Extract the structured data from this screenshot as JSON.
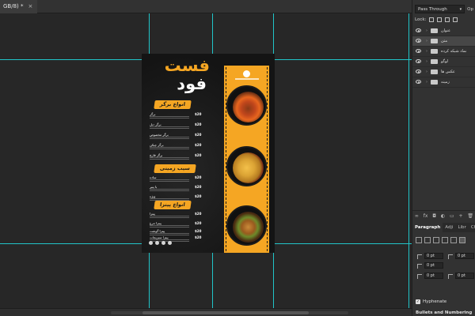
{
  "document_tab": {
    "title": "GB/8) *",
    "close_glyph": "×"
  },
  "poster": {
    "headline_1": "فست",
    "headline_2": "فود",
    "sections": [
      {
        "badge": "انواع برگر"
      },
      {
        "badge": "سیب زمینی"
      },
      {
        "badge": "انواع پیتزا"
      }
    ],
    "menu_items": [
      {
        "name": "برگر",
        "price": "$20"
      },
      {
        "name": "برگر دبل",
        "price": "$20"
      },
      {
        "name": "برگر مخصوص",
        "price": "$20"
      },
      {
        "name": "برگر چیکن",
        "price": "$20"
      },
      {
        "name": "برگر قارچ",
        "price": "$20"
      },
      {
        "name": "ساده",
        "price": "$20"
      },
      {
        "name": "با پنیر",
        "price": "$20"
      },
      {
        "name": "ویژه",
        "price": "$20"
      },
      {
        "name": "پیتزا",
        "price": "$20"
      },
      {
        "name": "پیتزا مرغ",
        "price": "$20"
      },
      {
        "name": "پیتزا گوشت",
        "price": "$20"
      },
      {
        "name": "پیتزا سبزیجات",
        "price": "$20"
      }
    ],
    "colors": {
      "accent": "#f5a623",
      "background": "#181818",
      "text": "#ffffff"
    }
  },
  "layers_panel": {
    "blend_mode": "Pass Through",
    "opacity_label": "Op",
    "lock_label": "Lock:",
    "layers": [
      {
        "name": "عنوان",
        "selected": false
      },
      {
        "name": "متن",
        "selected": true
      },
      {
        "name": "نماد شبکه کرده",
        "selected": false
      },
      {
        "name": "لوگو",
        "selected": false
      },
      {
        "name": "عکس ها",
        "selected": false
      },
      {
        "name": "زمینه",
        "selected": false
      }
    ],
    "toolbar": {
      "link": "∞",
      "fx": "fx",
      "mask": "◘",
      "adjust": "◐",
      "group": "▭",
      "new": "+",
      "delete": "🗑"
    }
  },
  "paragraph_panel": {
    "tabs": [
      "Paragraph",
      "Adji",
      "Libr",
      "Cha"
    ],
    "active_tab": "Paragraph",
    "fields": [
      "0 pt",
      "0 pt",
      "0 pt",
      "0 pt",
      "0 pt"
    ],
    "hyphenate_label": "Hyphenate",
    "bullets_label": "Bullets and Numbering"
  }
}
